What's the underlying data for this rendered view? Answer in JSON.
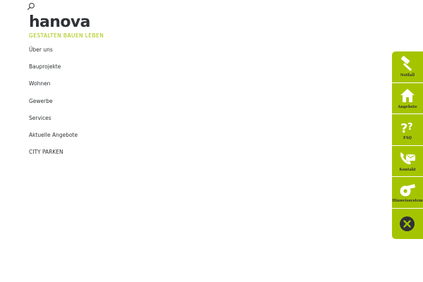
{
  "header": {
    "search_icon": "search-icon",
    "logo_text": "hanova",
    "tagline": "GESTALTEN BAUEN LEBEN"
  },
  "nav": {
    "items": [
      {
        "label": "Über uns"
      },
      {
        "label": "Bauprojekte"
      },
      {
        "label": "Wohnen"
      },
      {
        "label": "Gewerbe"
      },
      {
        "label": "Services"
      },
      {
        "label": "Aktuelle Angebote"
      },
      {
        "label": "CITY PARKEN"
      }
    ]
  },
  "quickbar": {
    "accent_color": "#a5c400",
    "items": [
      {
        "label": "Notfall",
        "icon": "hammer-icon"
      },
      {
        "label": "Angebote",
        "icon": "house-icon"
      },
      {
        "label": "FAQ",
        "icon": "question-icon"
      },
      {
        "label": "Kontakt",
        "icon": "phone-mail-icon"
      },
      {
        "label": "Hinweissystem",
        "icon": "whistle-icon"
      }
    ],
    "close_icon": "close-icon"
  }
}
